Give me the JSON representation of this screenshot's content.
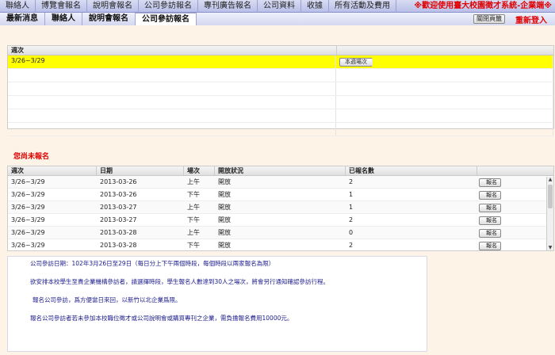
{
  "topbar": {
    "menu": [
      "聯絡人",
      "博覽會報名",
      "說明會報名",
      "公司參訪報名",
      "專刊廣告報名",
      "公司資料",
      "收據",
      "所有活動及費用"
    ],
    "notice": "※歡迎使用臺大校園徵才系統-企業端※"
  },
  "subbar": {
    "tabs": [
      "最新消息",
      "聯絡人",
      "說明會報名",
      "公司參訪報名"
    ],
    "active_tab": "公司參訪報名",
    "close_label": "關閉頁籤",
    "logout_label": "重新登入"
  },
  "session_table": {
    "header": "週次",
    "rows": [
      {
        "week": "3/26~3/29",
        "button": "本週場次",
        "selected": true
      },
      {
        "week": "",
        "button": ""
      },
      {
        "week": "",
        "button": ""
      },
      {
        "week": "",
        "button": ""
      },
      {
        "week": "",
        "button": ""
      },
      {
        "week": "",
        "button": ""
      }
    ]
  },
  "unregistered_title": "您尚未報名",
  "avail_table": {
    "headers": [
      "週次",
      "日期",
      "場次",
      "開放狀況",
      "已報名數",
      ""
    ],
    "rows": [
      {
        "week": "3/26~3/29",
        "date": "2013-03-26",
        "session": "上午",
        "status": "開放",
        "count": "2",
        "button": "報名"
      },
      {
        "week": "3/26~3/29",
        "date": "2013-03-26",
        "session": "下午",
        "status": "開放",
        "count": "1",
        "button": "報名"
      },
      {
        "week": "3/26~3/29",
        "date": "2013-03-27",
        "session": "上午",
        "status": "開放",
        "count": "1",
        "button": "報名"
      },
      {
        "week": "3/26~3/29",
        "date": "2013-03-27",
        "session": "下午",
        "status": "開放",
        "count": "2",
        "button": "報名"
      },
      {
        "week": "3/26~3/29",
        "date": "2013-03-28",
        "session": "上午",
        "status": "開放",
        "count": "0",
        "button": "報名"
      },
      {
        "week": "3/26~3/29",
        "date": "2013-03-28",
        "session": "下午",
        "status": "開放",
        "count": "2",
        "button": "報名"
      }
    ]
  },
  "notes": [
    "公司參訪日期：102年3月26日至29日（每日分上下午兩個時段，每個時段以兩家報名為限）",
    "欲安排本校學生至貴企業機構參訪者，請選擇時段，學生報名人數達到30人之場次，將會另行通知確認參訪行程。",
    "報名公司參訪，爲方便當日來回，以新竹以北企業爲限。",
    "報名公司參訪者若未參加本校職位徵才或公司說明會或購買專刊之企業，需負擔報名費用10000元。"
  ]
}
